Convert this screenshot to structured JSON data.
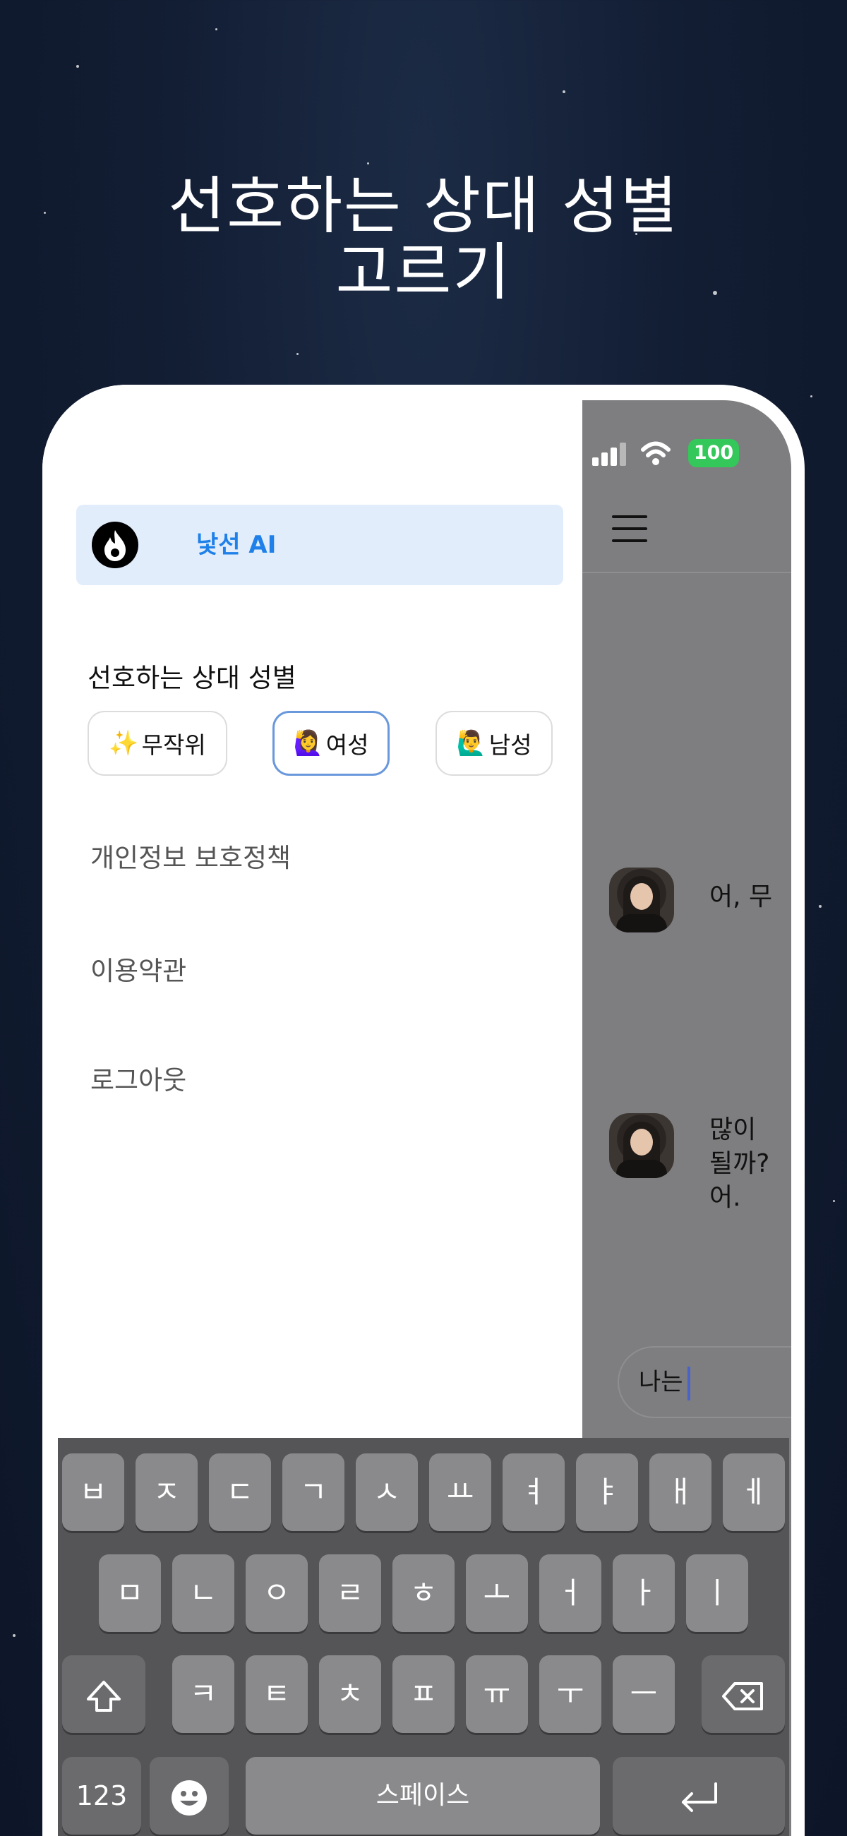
{
  "headline": {
    "line1": "선호하는 상대 성별",
    "line2": "고르기"
  },
  "status_bar": {
    "battery": "100"
  },
  "drawer": {
    "app_name": "낯선 AI",
    "gender_section_label": "선호하는 상대 성별",
    "gender_options": [
      {
        "emoji": "✨",
        "label": "무작위",
        "selected": false
      },
      {
        "emoji": "🙋‍♀️",
        "label": "여성",
        "selected": true
      },
      {
        "emoji": "🙋‍♂️",
        "label": "남성",
        "selected": false
      }
    ],
    "links": [
      "개인정보 보호정책",
      "이용약관",
      "로그아웃"
    ]
  },
  "chat": {
    "messages": [
      "어, 무",
      "많이 \n될까?\n어."
    ],
    "input_value": "나는"
  },
  "keyboard": {
    "row1": [
      "ㅂ",
      "ㅈ",
      "ㄷ",
      "ㄱ",
      "ㅅ",
      "ㅛ",
      "ㅕ",
      "ㅑ",
      "ㅐ",
      "ㅔ"
    ],
    "row2": [
      "ㅁ",
      "ㄴ",
      "ㅇ",
      "ㄹ",
      "ㅎ",
      "ㅗ",
      "ㅓ",
      "ㅏ",
      "ㅣ"
    ],
    "row3": [
      "ㅋ",
      "ㅌ",
      "ㅊ",
      "ㅍ",
      "ㅠ",
      "ㅜ",
      "ㅡ"
    ],
    "numbers_key": "123",
    "space_key": "스페이스"
  },
  "colors": {
    "accent": "#1e80e8",
    "selected_border": "#6a98dc",
    "battery": "#34c759"
  }
}
